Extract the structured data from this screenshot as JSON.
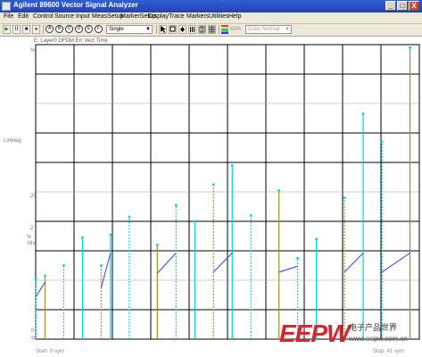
{
  "window": {
    "title": "Agilent 89600 Vector Signal Analyzer",
    "minimize_label": "_",
    "maximize_label": "□",
    "close_label": "X"
  },
  "menu": [
    "File",
    "Edit",
    "Control",
    "Source",
    "Input",
    "MeasSetup",
    "MarkerSetup",
    "Display",
    "Trace",
    "Markers",
    "Utilities",
    "Help"
  ],
  "toolbar": {
    "play_label": "▶",
    "pause_label": "II",
    "stop_label": "■",
    "record_label": "●",
    "round_buttons": [
      "A",
      "B",
      "C",
      "D",
      "E",
      "F"
    ],
    "single_select_value": "Single",
    "percent_value": "63%",
    "color_select_value": "Color Normal"
  },
  "trace": {
    "title": "E: Layer0 OFDM Err Vect Time",
    "y_axis_labels": [
      {
        "text": "20",
        "row": 0
      },
      {
        "text": "%",
        "row": 1
      },
      {
        "text": "LinMag",
        "row": 2
      },
      {
        "text": "2",
        "row": 3
      },
      {
        "text": "%",
        "row": 4
      },
      {
        "text": "/div",
        "row": 5
      },
      {
        "text": "0",
        "row": 6
      },
      {
        "text": "%",
        "row": 7
      }
    ],
    "start_label": "Start: 0  sym",
    "stop_label": "Stop: 41  sym"
  },
  "chart_data": {
    "type": "scatter",
    "title": "E: Layer0 OFDM Err Vect Time",
    "ylabel": "LinMag",
    "ylim": [
      0,
      20
    ],
    "xlim": [
      0,
      41
    ],
    "grid": true,
    "x_unit": "sym",
    "y_unit": "%",
    "y_scale_per_div": "2 %/div",
    "series": [
      {
        "color": "#00d2d2",
        "values": [
          {
            "x": 0,
            "y": 4.1
          },
          {
            "x": 1,
            "y": 4.3
          },
          {
            "x": 3,
            "y": 5.0
          },
          {
            "x": 5,
            "y": 6.9
          },
          {
            "x": 7,
            "y": 5.0
          },
          {
            "x": 8,
            "y": 7.1
          },
          {
            "x": 10,
            "y": 8.3
          },
          {
            "x": 13,
            "y": 6.4
          },
          {
            "x": 15,
            "y": 9.1
          },
          {
            "x": 17,
            "y": 8.0
          },
          {
            "x": 19,
            "y": 10.5
          },
          {
            "x": 21,
            "y": 11.8
          },
          {
            "x": 23,
            "y": 8.4
          },
          {
            "x": 26,
            "y": 10.1
          },
          {
            "x": 28,
            "y": 5.5
          },
          {
            "x": 30,
            "y": 6.8
          },
          {
            "x": 33,
            "y": 9.6
          },
          {
            "x": 35,
            "y": 15.3
          },
          {
            "x": 37,
            "y": 13.4
          },
          {
            "x": 40,
            "y": 19.8
          }
        ]
      }
    ]
  },
  "watermark": {
    "brand": "EEPW",
    "chinese": "电子产品世界",
    "url": "www.eepw.com.cn"
  },
  "colors": {
    "title_bar": "#2657c8",
    "trace_cyan": "#00d2d2",
    "trace_olive": "#9c8f2a",
    "trace_blue": "#3b4fd8",
    "grid": "#000000",
    "brand_red": "#d8252f"
  }
}
